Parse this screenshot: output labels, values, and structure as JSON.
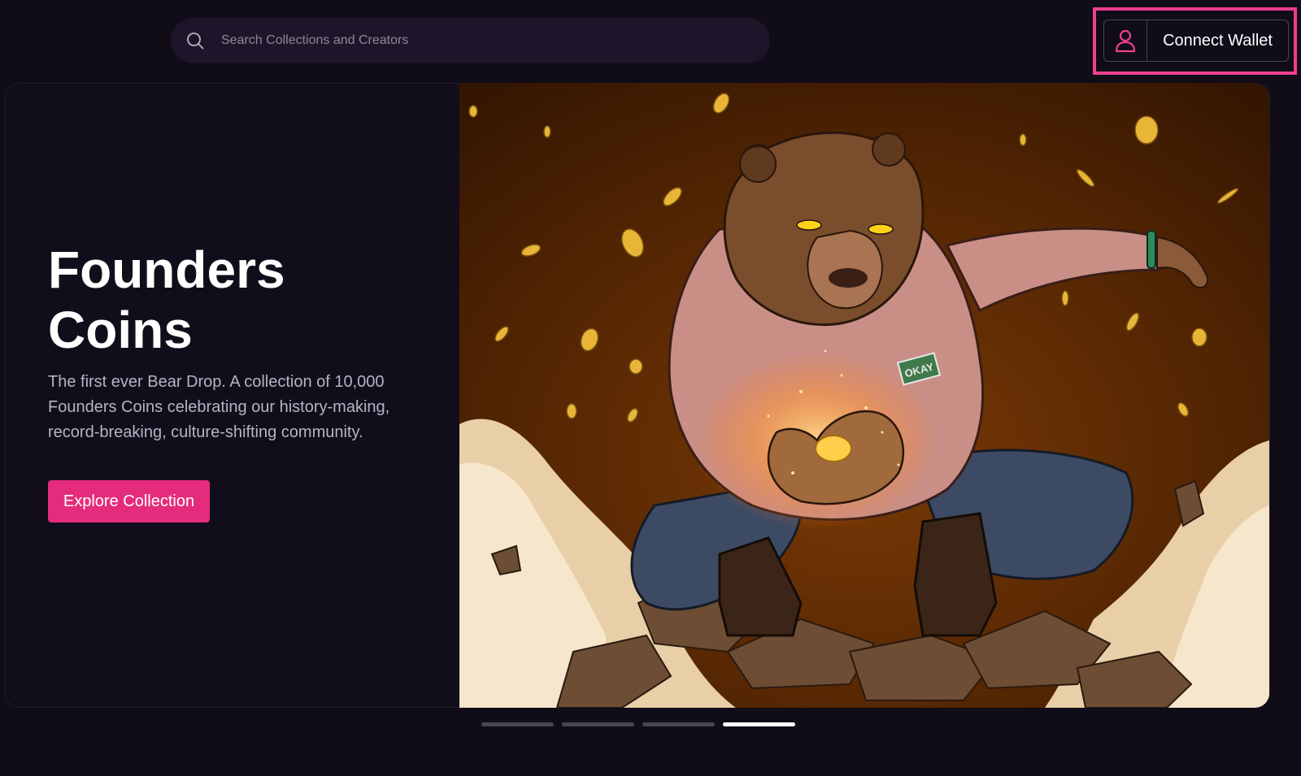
{
  "search": {
    "placeholder": "Search Collections and Creators",
    "icon": "search-icon"
  },
  "wallet": {
    "label": "Connect Wallet",
    "icon": "user-icon",
    "accent": "#ee3f8d"
  },
  "hero": {
    "title": "Founders Coins",
    "description": "The first ever Bear Drop. A collection of 10,000 Founders Coins celebrating our history-making, record-breaking, culture-shifting community.",
    "cta": "Explore Collection",
    "cta_color": "#e52b7b",
    "artwork": {
      "subject": "bear-in-hoodie-holding-glowing-coin",
      "patch_text": "OKAY"
    }
  },
  "carousel": {
    "slides": 4,
    "active_index": 3
  },
  "colors": {
    "background": "#100c18",
    "card": "#120d1b",
    "search_bg": "#1d1529"
  }
}
